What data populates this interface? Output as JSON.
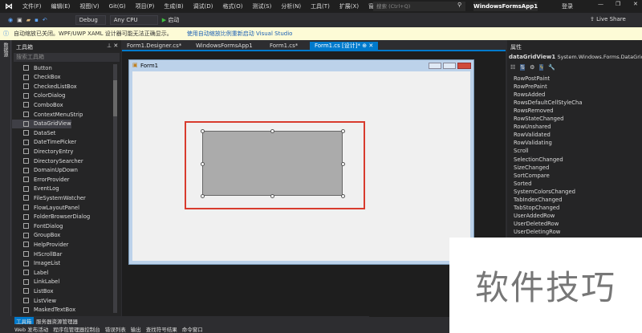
{
  "menu": [
    "文件(F)",
    "编辑(E)",
    "视图(V)",
    "Git(G)",
    "项目(P)",
    "生成(B)",
    "调试(D)",
    "格式(O)",
    "测试(S)",
    "分析(N)",
    "工具(T)",
    "扩展(X)",
    "窗口(W)",
    "帮助(H)"
  ],
  "search_placeholder": "搜索 (Ctrl+Q)",
  "app_title": "WindowsFormsApp1",
  "login": "登录",
  "toolbar": {
    "config": "Debug",
    "platform": "Any CPU",
    "start": "启动",
    "live_share": "Live Share"
  },
  "infobar": {
    "message": "自动缩放已关闭。WPF/UWP XAML 设计器可能无法正确显示。",
    "link": "使用自动缩放比例重新启动 Visual Studio"
  },
  "left_strip": "数据源",
  "toolbox": {
    "title": "工具箱",
    "search_placeholder": "搜索工具箱",
    "items": [
      "Button",
      "CheckBox",
      "CheckedListBox",
      "ColorDialog",
      "ComboBox",
      "ContextMenuStrip",
      "DataGridView",
      "DataSet",
      "DateTimePicker",
      "DirectoryEntry",
      "DirectorySearcher",
      "DomainUpDown",
      "ErrorProvider",
      "EventLog",
      "FileSystemWatcher",
      "FlowLayoutPanel",
      "FolderBrowserDialog",
      "FontDialog",
      "GroupBox",
      "HelpProvider",
      "HScrollBar",
      "ImageList",
      "Label",
      "LinkLabel",
      "ListBox",
      "ListView",
      "MaskedTextBox"
    ]
  },
  "tabs": [
    "Form1.Designer.cs*",
    "WindowsFormsApp1",
    "Form1.cs*",
    "Form1.cs [设计]*"
  ],
  "form_title": "Form1",
  "properties": {
    "title": "属性",
    "object": "dataGridView1",
    "type": "System.Windows.Forms.DataGridView",
    "events": [
      "RowPostPaint",
      "RowPrePaint",
      "RowsAdded",
      "RowsDefaultCellStyleCha",
      "RowsRemoved",
      "RowStateChanged",
      "RowUnshared",
      "RowValidated",
      "RowValidating",
      "Scroll",
      "SelectionChanged",
      "SizeChanged",
      "SortCompare",
      "Sorted",
      "SystemColorsChanged",
      "TabIndexChanged",
      "TabStopChanged",
      "UserAddedRow",
      "UserDeletedRow",
      "UserDeletingRow"
    ]
  },
  "bottom_tabs": [
    "工具箱",
    "服务器资源管理器"
  ],
  "status_tabs": [
    "Web 发布活动",
    "程序包管理器控制台",
    "错误列表",
    "输出",
    "查找符号结果",
    "命令窗口"
  ],
  "watermark": "软件技巧"
}
